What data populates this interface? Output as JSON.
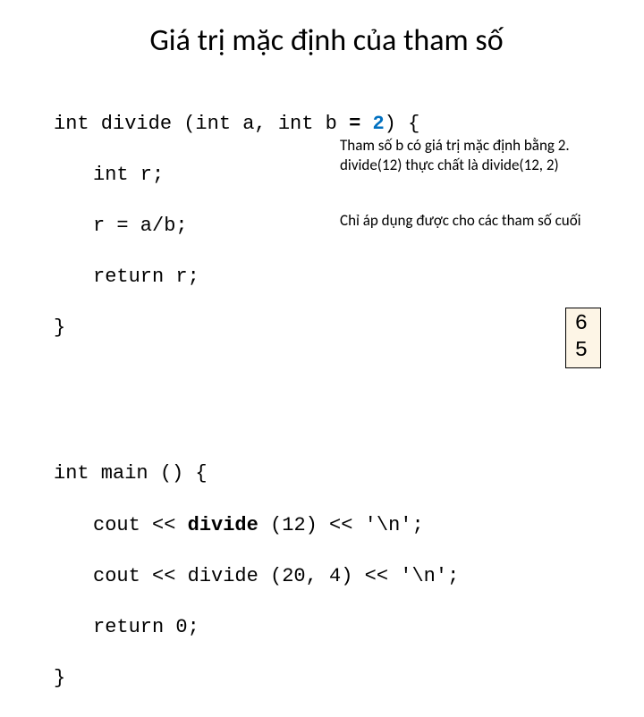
{
  "title": "Giá trị mặc định của tham số",
  "code1": {
    "l1a": "int divide (int a, int b ",
    "l1eq": "=",
    "l1sp": " ",
    "l1num": "2",
    "l1b": ") {",
    "l2": "int r;",
    "l3": "r = a/b;",
    "l4": "return r;",
    "l5": "}"
  },
  "notes": {
    "n1a": "Tham số b có giá trị mặc định bằng 2.",
    "n1b": "divide(12) thực chất là divide(12, 2)",
    "n2": "Chỉ áp dụng được cho các tham số cuối"
  },
  "code2": {
    "l1": "int main () {",
    "l2a": "cout << ",
    "l2b": "divide",
    "l2c": " (12) << '\\n';",
    "l3": "cout << divide (20, 4) << '\\n';",
    "l4": "return 0;",
    "l5": "}"
  },
  "output": {
    "o1": "6",
    "o2": "5"
  }
}
